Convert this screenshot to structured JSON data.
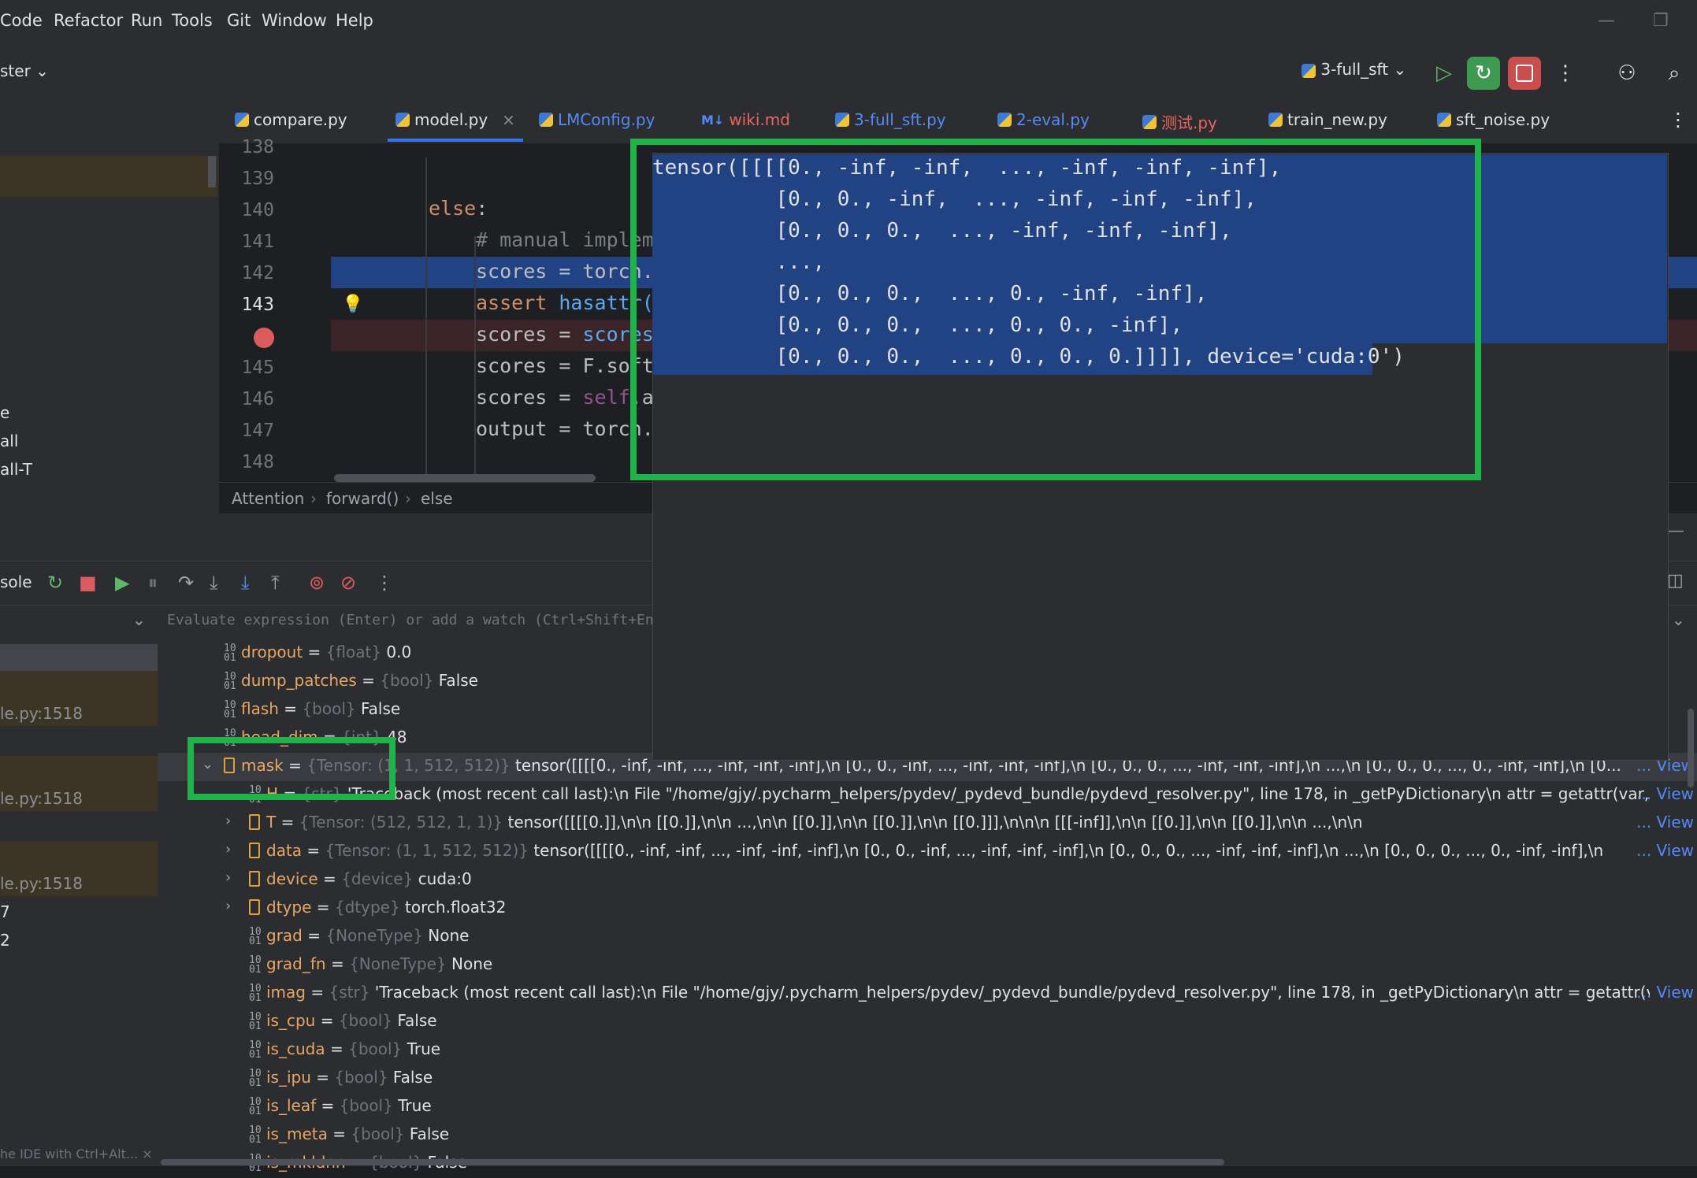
{
  "menu": [
    "Code",
    "Refactor",
    "Run",
    "Tools",
    "Git",
    "Window",
    "Help"
  ],
  "toolbar": {
    "branch": "ster",
    "run_config": "3-full_sft"
  },
  "tabs": [
    {
      "label": "compare.py",
      "color": "#dfe1e5"
    },
    {
      "label": "model.py",
      "color": "#dfe1e5"
    },
    {
      "label": "LMConfig.py",
      "color": "#548af7"
    },
    {
      "label": "wiki.md",
      "color": "#e8665e"
    },
    {
      "label": "3-full_sft.py",
      "color": "#548af7"
    },
    {
      "label": "2-eval.py",
      "color": "#548af7"
    },
    {
      "label": "测试.py",
      "color": "#e8665e"
    },
    {
      "label": "train_new.py",
      "color": "#dfe1e5"
    },
    {
      "label": "sft_noise.py",
      "color": "#dfe1e5"
    }
  ],
  "wiki_prefix": "M↓",
  "left_panel": [
    "e",
    "all",
    "all-T"
  ],
  "gutter": [
    "138",
    "139",
    "140",
    "141",
    "142",
    "143",
    "145",
    "146",
    "147",
    "148"
  ],
  "code": {
    "l139": "",
    "l140_kw": "else",
    "l140_rest": ":",
    "l141": "# manual implem",
    "l142": "scores = torch.",
    "l143_a": "assert ",
    "l143_b": "hasattr(",
    "l144_a": "scores = ",
    "l144_b": "scores",
    "l145": "scores = F.soft",
    "l146_a": "scores = ",
    "l146_b": "self",
    "l146_c": ".a",
    "l147": "output = torch."
  },
  "breadcrumbs": [
    "Attention",
    "forward()",
    "else"
  ],
  "debug": {
    "console_label": "sole",
    "watch_placeholder": "Evaluate expression (Enter) or add a watch (Ctrl+Shift+Enter)"
  },
  "frames": [
    "le.py:1518",
    "le.py:1518",
    "le.py:1518",
    "7",
    "2"
  ],
  "status_hint": "he IDE with Ctrl+Alt...",
  "popup_lines": [
    "tensor([[[[0., -inf, -inf,  ..., -inf, -inf, -inf],",
    "          [0., 0., -inf,  ..., -inf, -inf, -inf],",
    "          [0., 0., 0.,  ..., -inf, -inf, -inf],",
    "          ...,",
    "          [0., 0., 0.,  ..., 0., -inf, -inf],",
    "          [0., 0., 0.,  ..., 0., 0., -inf],",
    "          [0., 0., 0.,  ..., 0., 0., 0.]]]], device='cuda:0')"
  ],
  "vars": [
    {
      "name": "dropout",
      "type": "{float}",
      "val": "0.0",
      "indent": 0,
      "kind": "prim"
    },
    {
      "name": "dump_patches",
      "type": "{bool}",
      "val": "False",
      "indent": 0,
      "kind": "prim"
    },
    {
      "name": "flash",
      "type": "{bool}",
      "val": "False",
      "indent": 0,
      "kind": "prim"
    },
    {
      "name": "head_dim",
      "type": "{int}",
      "val": "48",
      "indent": 0,
      "kind": "prim"
    },
    {
      "name": "mask",
      "type": "{Tensor: (1, 1, 512, 512)}",
      "val": "tensor([[[[0., -inf, -inf,  ..., -inf, -inf, -inf],\\n        [0., 0., -inf,  ..., -inf, -inf, -inf],\\n        [0., 0., 0.,  ..., -inf, -inf, -inf],\\n        ...,\\n        [0., 0., 0.,  ..., 0., -inf, -inf],\\n        [0...",
      "indent": 0,
      "kind": "obj",
      "expanded": true,
      "view": "View"
    },
    {
      "name": "H",
      "type": "{str}",
      "val": "'Traceback (most recent call last):\\n  File \"/home/gjy/.pycharm_helpers/pydev/_pydevd_bundle/pydevd_resolver.py\", line 178, in _getPyDictionary\\n    attr = getattr(var, n)\\nRuntimeErr...",
      "indent": 1,
      "kind": "prim",
      "view": "View"
    },
    {
      "name": "T",
      "type": "{Tensor: (512, 512, 1, 1)}",
      "val": "tensor([[[[0.]],\\n\\n        [[0.]],\\n\\n        ...,\\n\\n        [[0.]],\\n\\n        [[0.]],\\n\\n        [[0.]]],\\n\\n\\n       [[[-inf]],\\n\\n        [[0.]],\\n\\n        [[0.]],\\n\\n        ...,\\n\\n",
      "indent": 1,
      "kind": "obj",
      "view": "View"
    },
    {
      "name": "data",
      "type": "{Tensor: (1, 1, 512, 512)}",
      "val": "tensor([[[[0., -inf, -inf,  ..., -inf, -inf, -inf],\\n        [0., 0., -inf,  ..., -inf, -inf, -inf],\\n        [0., 0., 0.,  ..., -inf, -inf, -inf],\\n        ...,\\n        [0., 0., 0.,  ..., 0., -inf, -inf],\\n",
      "indent": 1,
      "kind": "obj",
      "view": "View"
    },
    {
      "name": "device",
      "type": "{device}",
      "val": "cuda:0",
      "indent": 1,
      "kind": "obj"
    },
    {
      "name": "dtype",
      "type": "{dtype}",
      "val": "torch.float32",
      "indent": 1,
      "kind": "obj"
    },
    {
      "name": "grad",
      "type": "{NoneType}",
      "val": "None",
      "indent": 1,
      "kind": "prim"
    },
    {
      "name": "grad_fn",
      "type": "{NoneType}",
      "val": "None",
      "indent": 1,
      "kind": "prim"
    },
    {
      "name": "imag",
      "type": "{str}",
      "val": "'Traceback (most recent call last):\\n  File \"/home/gjy/.pycharm_helpers/pydev/_pydevd_bundle/pydevd_resolver.py\", line 178, in _getPyDictionary\\n    attr = getattr(var, n)\\nRuntime...",
      "indent": 1,
      "kind": "prim",
      "view": "View"
    },
    {
      "name": "is_cpu",
      "type": "{bool}",
      "val": "False",
      "indent": 1,
      "kind": "prim"
    },
    {
      "name": "is_cuda",
      "type": "{bool}",
      "val": "True",
      "indent": 1,
      "kind": "prim"
    },
    {
      "name": "is_ipu",
      "type": "{bool}",
      "val": "False",
      "indent": 1,
      "kind": "prim"
    },
    {
      "name": "is_leaf",
      "type": "{bool}",
      "val": "True",
      "indent": 1,
      "kind": "prim"
    },
    {
      "name": "is_meta",
      "type": "{bool}",
      "val": "False",
      "indent": 1,
      "kind": "prim"
    },
    {
      "name": "is_mkldnn",
      "type": "{bool}",
      "val": "False",
      "indent": 1,
      "kind": "prim"
    }
  ],
  "eq": " = "
}
